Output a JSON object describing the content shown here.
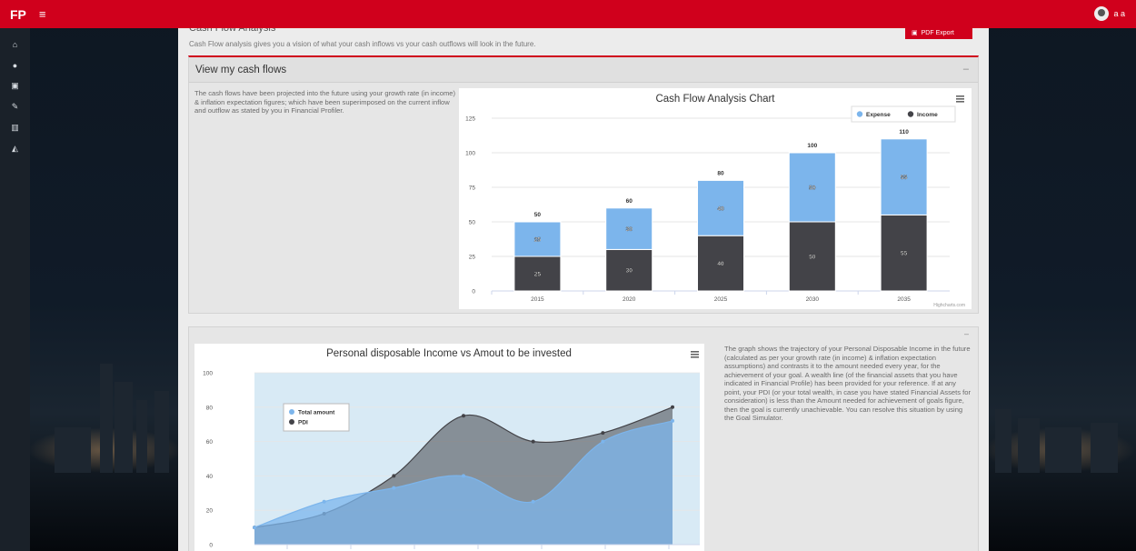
{
  "app": {
    "logo": "FP",
    "menu_icon": "menu-icon",
    "user_name": "a a"
  },
  "sidebar": {
    "items": [
      {
        "icon": "home-icon",
        "glyph": "⌂"
      },
      {
        "icon": "user-icon",
        "glyph": "●"
      },
      {
        "icon": "document-icon",
        "glyph": "▣"
      },
      {
        "icon": "tools-icon",
        "glyph": "✎"
      },
      {
        "icon": "bar-chart-icon",
        "glyph": "▥"
      },
      {
        "icon": "growth-chart-icon",
        "glyph": "◭"
      }
    ]
  },
  "page": {
    "intro": "Cash Flow analysis gives you a vision of what your cash inflows vs your cash outflows will look in the future.",
    "pdf_export_label": "PDF Export",
    "section_title": "Cash Flow Analysis"
  },
  "cashflow_panel": {
    "title": "View my cash flows",
    "collapse": "–",
    "description": "The cash flows have been projected into the future using your growth rate (in income) & inflation expectation figures; which have been superimposed on the current inflow and outflow as stated by you in Financial Profiler."
  },
  "pdi_panel": {
    "collapse": "–",
    "description": "The graph shows the trajectory of your Personal Disposable Income in the future (calculated as per your growth rate (in income) & inflation expectation assumptions) and contrasts it to the amount needed every year, for the achievement of your goal. A wealth line (of the financial assets that you have indicated in Financial Profile) has been provided for your reference. If at any point, your PDI (or your total wealth, in case you have stated Financial Assets for consideration) is less than the Amount needed for achievement of goals figure, then the goal is currently unachievable. You can resolve this situation by using the Goal Simulator."
  },
  "chart_data": [
    {
      "type": "bar",
      "stacked": true,
      "title": "Cash Flow Analysis Chart",
      "categories": [
        "2015",
        "2020",
        "2025",
        "2030",
        "2035"
      ],
      "series": [
        {
          "name": "Expense",
          "values": [
            25,
            30,
            40,
            50,
            55
          ],
          "color": "#7cb5ec"
        },
        {
          "name": "Income",
          "values": [
            25,
            30,
            40,
            50,
            55
          ],
          "color": "#434348"
        }
      ],
      "totals": [
        50,
        60,
        80,
        100,
        110
      ],
      "yticks": [
        "0",
        "25",
        "50",
        "75",
        "100",
        "125"
      ],
      "ylim": [
        0,
        125
      ],
      "legend": "top-right",
      "credits": "Highcharts.com",
      "menu_icon": "chart-menu-icon"
    },
    {
      "type": "area",
      "title": "Personal disposable Income vs Amout to be invested",
      "series": [
        {
          "name": "Total amount",
          "values": [
            10,
            25,
            33,
            40,
            25,
            60,
            72
          ],
          "color": "#7cb5ec"
        },
        {
          "name": "PDI",
          "values": [
            10,
            18,
            40,
            75,
            60,
            65,
            80
          ],
          "color": "#434348"
        }
      ],
      "yticks": [
        "0",
        "20",
        "40",
        "60",
        "80",
        "100"
      ],
      "ylim": [
        0,
        100
      ],
      "legend": "top-left",
      "menu_icon": "chart-menu-icon"
    }
  ]
}
